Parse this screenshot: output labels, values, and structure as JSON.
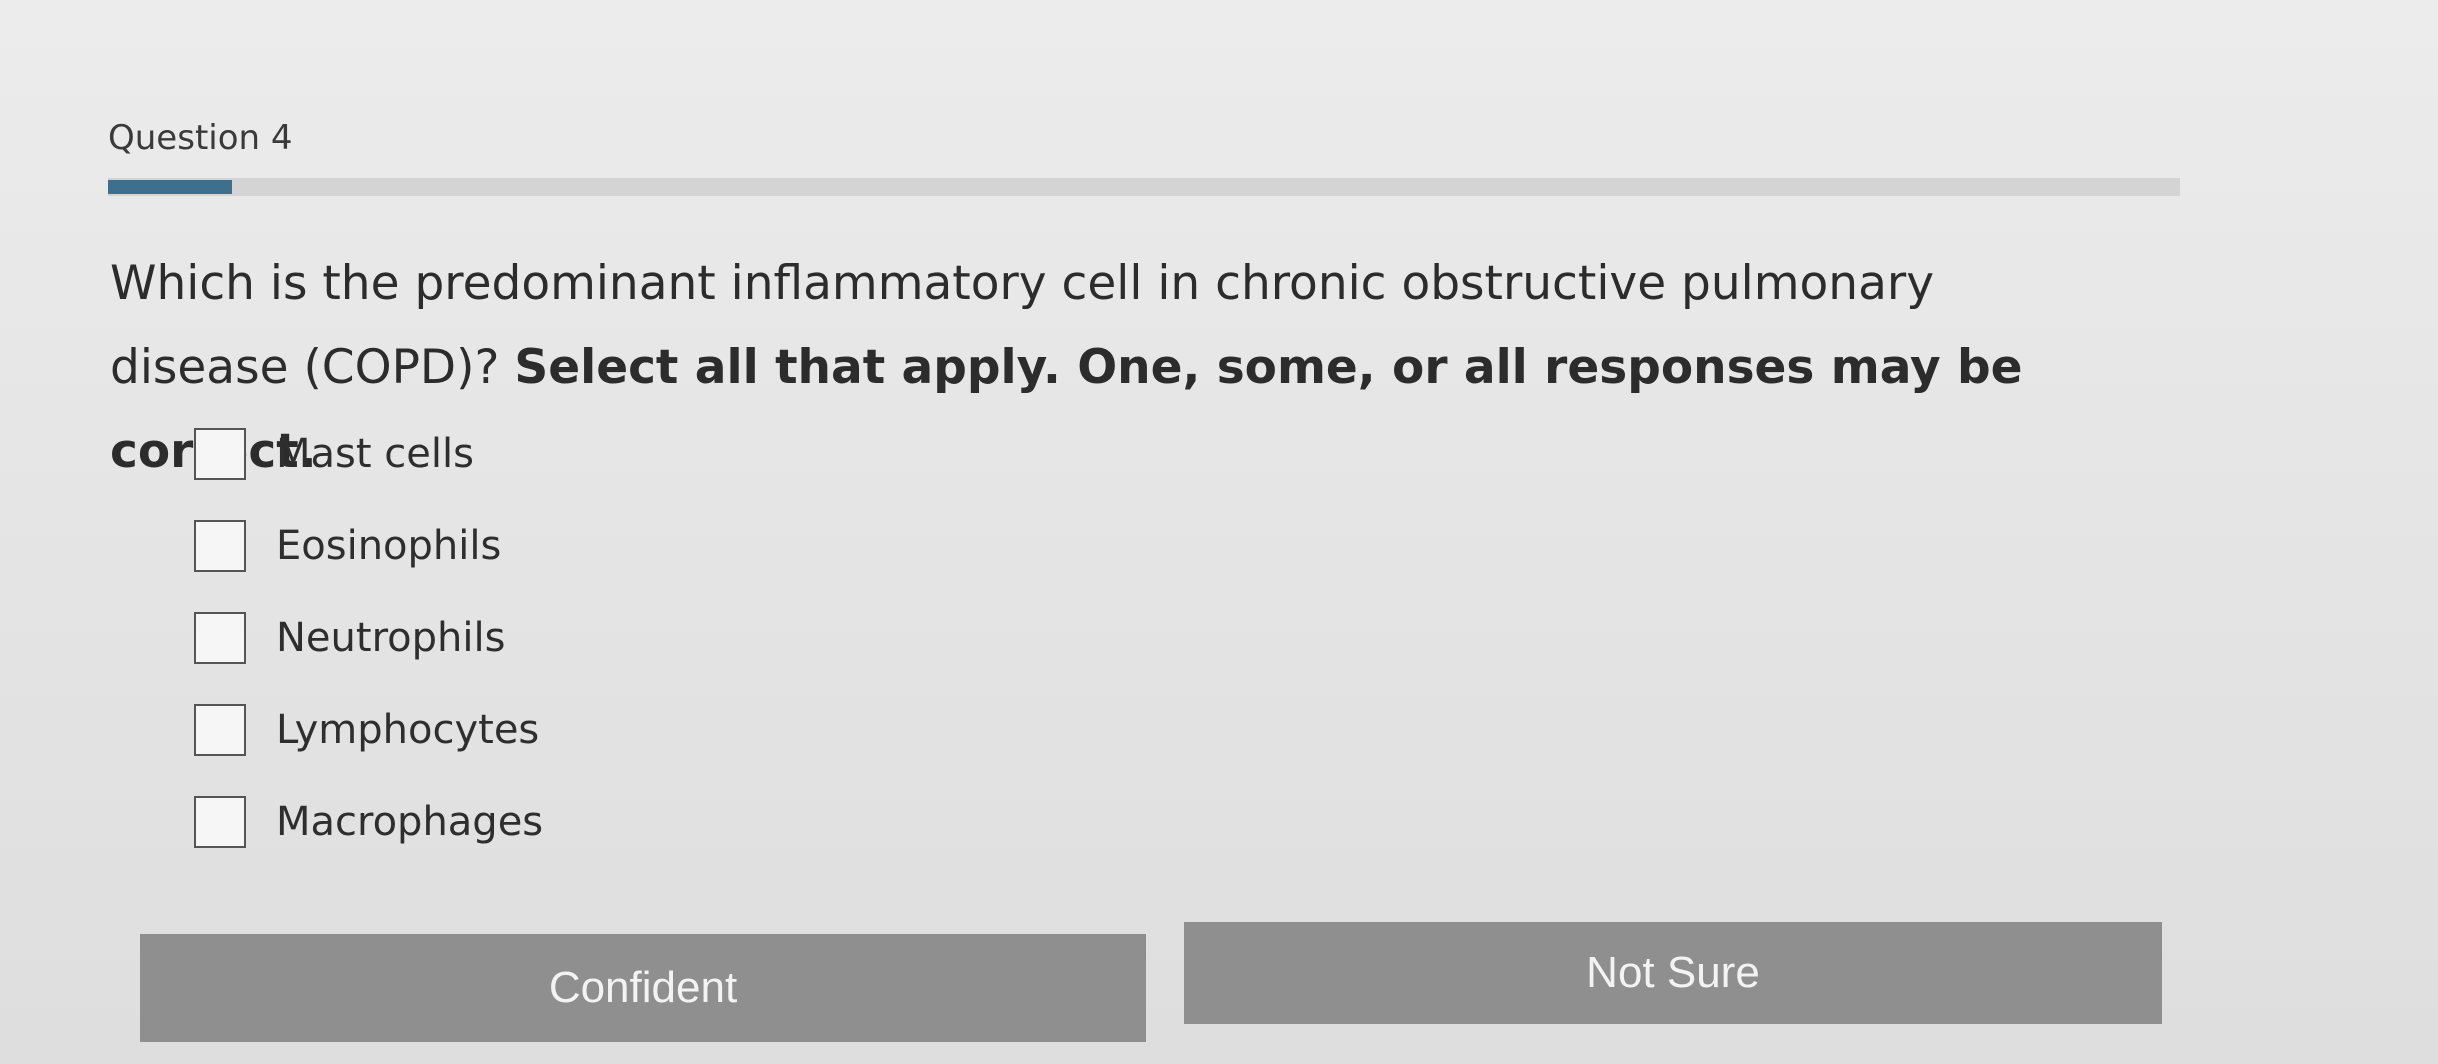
{
  "question": {
    "label": "Question 4",
    "progress_fraction": 0.06,
    "progress_color": "#3e6f8c",
    "text_regular": "Which is the predominant inflammatory cell in chronic obstructive pulmonary disease (COPD)?",
    "text_bold": "Select all that apply. One, some, or all responses may be correct."
  },
  "options": [
    {
      "label": "Mast cells",
      "checked": false
    },
    {
      "label": "Eosinophils",
      "checked": false
    },
    {
      "label": "Neutrophils",
      "checked": false
    },
    {
      "label": "Lymphocytes",
      "checked": false
    },
    {
      "label": "Macrophages",
      "checked": false
    }
  ],
  "buttons": {
    "confident": "Confident",
    "not_sure": "Not Sure"
  }
}
